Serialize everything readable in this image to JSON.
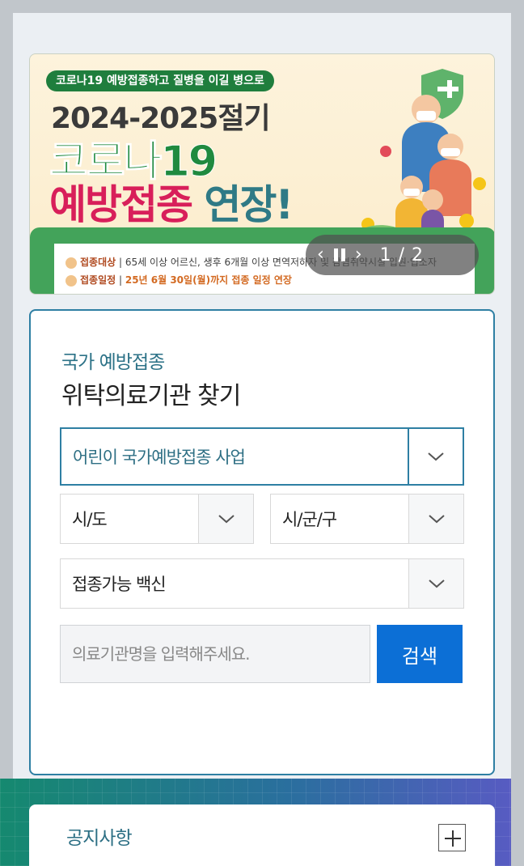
{
  "banner": {
    "pill": "코로나19 예방접종하고 질병을 이길 병으로",
    "season": "2024-2025절기",
    "line1": "코로나19",
    "line2_a": "예방접종",
    "line2_b": "연장!",
    "target_tag": "접종대상",
    "target_text": "65세 이상 어르신, 생후 6개월 이상 면역저하자 및 감염취약시설 입원·입소자",
    "period_tag": "접종일정",
    "period_text": "25년 6월 30일(월)까지 접종 일정 연장",
    "colors": {
      "green": "#1f8a3f",
      "red": "#d81f5a",
      "teal": "#2f7a86"
    }
  },
  "carousel": {
    "prev_icon": "chevron-left-icon",
    "next_icon": "chevron-right-icon",
    "counter": "1 / 2"
  },
  "search": {
    "subtitle": "국가 예방접종",
    "title": "위탁의료기관 찾기",
    "program_selected": "어린이 국가예방접종 사업",
    "sido_selected": "시/도",
    "sigungu_selected": "시/군/구",
    "vaccine_selected": "접종가능 백신",
    "input_placeholder": "의료기관명을 입력해주세요.",
    "button_label": "검색",
    "accent": "#2e7fa3",
    "button_color": "#0c6fd6"
  },
  "notice": {
    "label": "공지사항",
    "expand_icon": "plus-icon"
  }
}
